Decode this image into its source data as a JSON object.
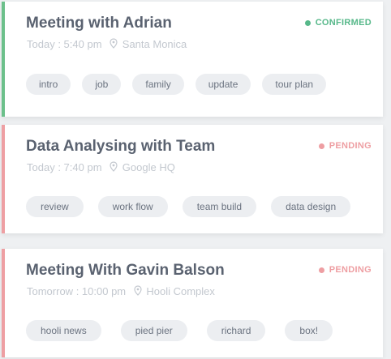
{
  "events": [
    {
      "title": "Meeting with Adrian",
      "day": "Today",
      "time": "5:40 pm",
      "location": "Santa Monica",
      "status": "CONFIRMED",
      "status_color": "#57b88a",
      "accent_color": "#6cc08b",
      "tags": [
        "intro",
        "job",
        "family",
        "update",
        "tour plan"
      ]
    },
    {
      "title": "Data Analysing with Team",
      "day": "Today",
      "time": "7:40 pm",
      "location": "Google HQ",
      "status": "PENDING",
      "status_color": "#ee9ea2",
      "accent_color": "#ee9fa3",
      "tags": [
        "review",
        "work flow",
        "team build",
        "data design"
      ]
    },
    {
      "title": "Meeting With Gavin Balson",
      "day": "Tomorrow",
      "time": "10:00 pm",
      "location": "Hooli Complex",
      "status": "PENDING",
      "status_color": "#ee9ea2",
      "accent_color": "#ee9fa3",
      "tags": [
        "hooli news",
        "pied pier",
        "richard",
        "box!"
      ]
    }
  ],
  "icons": {
    "location": "map-pin-icon",
    "status": "status-dot-icon"
  }
}
